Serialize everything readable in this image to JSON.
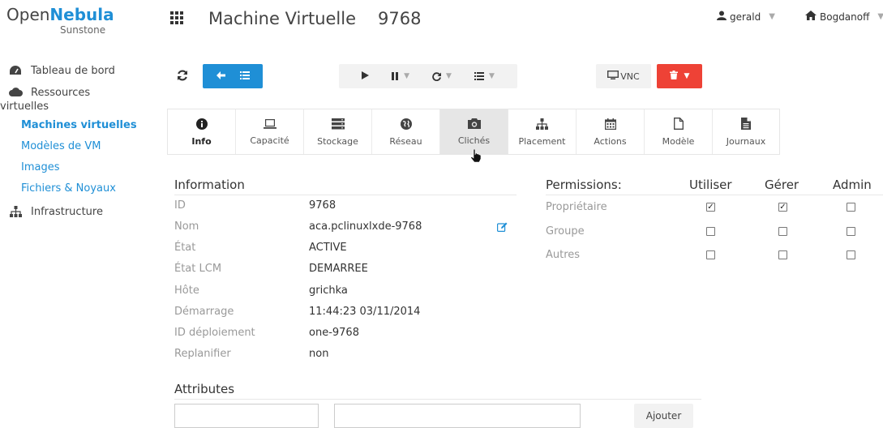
{
  "logo": {
    "part1": "Open",
    "part2": "Nebula",
    "sub": "Sunstone"
  },
  "header": {
    "title": "Machine Virtuelle",
    "vm_id": "9768",
    "user": "gerald",
    "zone": "Bogdanoff"
  },
  "sidebar": {
    "dashboard": "Tableau de bord",
    "resources_1": "Ressources",
    "resources_2": "virtuelles",
    "items": [
      "Machines virtuelles",
      "Modèles de VM",
      "Images",
      "Fichiers & Noyaux"
    ],
    "infrastructure": "Infrastructure"
  },
  "toolbar": {
    "vnc_label": "VNC"
  },
  "tabs": [
    {
      "label": "Info",
      "icon": "info-icon"
    },
    {
      "label": "Capacité",
      "icon": "laptop-icon"
    },
    {
      "label": "Stockage",
      "icon": "hdd-icon"
    },
    {
      "label": "Réseau",
      "icon": "globe-icon"
    },
    {
      "label": "Clichés",
      "icon": "camera-icon"
    },
    {
      "label": "Placement",
      "icon": "sitemap-icon"
    },
    {
      "label": "Actions",
      "icon": "calendar-icon"
    },
    {
      "label": "Modèle",
      "icon": "file-icon"
    },
    {
      "label": "Journaux",
      "icon": "file-text-icon"
    }
  ],
  "info": {
    "heading": "Information",
    "rows": [
      {
        "key": "ID",
        "value": "9768"
      },
      {
        "key": "Nom",
        "value": "aca.pclinuxlxde-9768"
      },
      {
        "key": "État",
        "value": "ACTIVE"
      },
      {
        "key": "État LCM",
        "value": "DEMARREE"
      },
      {
        "key": "Hôte",
        "value": "grichka"
      },
      {
        "key": "Démarrage",
        "value": "11:44:23 03/11/2014"
      },
      {
        "key": "ID déploiement",
        "value": "one-9768"
      },
      {
        "key": "Replanifier",
        "value": "non"
      }
    ]
  },
  "permissions": {
    "heading": "Permissions:",
    "columns": [
      "Utiliser",
      "Gérer",
      "Admin"
    ],
    "rows": [
      {
        "label": "Propriétaire",
        "checks": [
          true,
          true,
          false
        ]
      },
      {
        "label": "Groupe",
        "checks": [
          false,
          false,
          false
        ]
      },
      {
        "label": "Autres",
        "checks": [
          false,
          false,
          false
        ]
      }
    ]
  },
  "attributes": {
    "heading": "Attributes",
    "add_label": "Ajouter"
  },
  "colors": {
    "accent": "#1f8fd6",
    "danger": "#ee4236"
  }
}
